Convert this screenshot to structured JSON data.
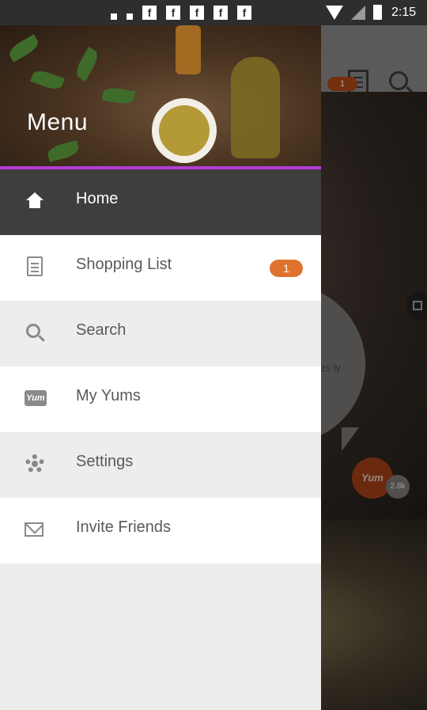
{
  "status_bar": {
    "time": "2:15",
    "notification_icons": [
      "f",
      "f",
      "f",
      "f",
      "f"
    ]
  },
  "background_app": {
    "shopping_list_badge": "1",
    "bubble_text": "ipes ly",
    "yum_button_label": "Yum",
    "yum_count": "2.8k"
  },
  "drawer": {
    "title": "Menu",
    "items": [
      {
        "label": "Home",
        "icon": "home-icon",
        "active": true
      },
      {
        "label": "Shopping List",
        "icon": "list-icon",
        "badge": "1"
      },
      {
        "label": "Search",
        "icon": "search-icon"
      },
      {
        "label": "My Yums",
        "icon": "yum-logo"
      },
      {
        "label": "Settings",
        "icon": "gear-icon"
      },
      {
        "label": "Invite Friends",
        "icon": "mail-icon"
      }
    ]
  },
  "colors": {
    "accent_divider": "#b43cd8",
    "active_row": "#3e3e3e",
    "badge": "#e0722f",
    "brand_yum": "#a54118"
  }
}
